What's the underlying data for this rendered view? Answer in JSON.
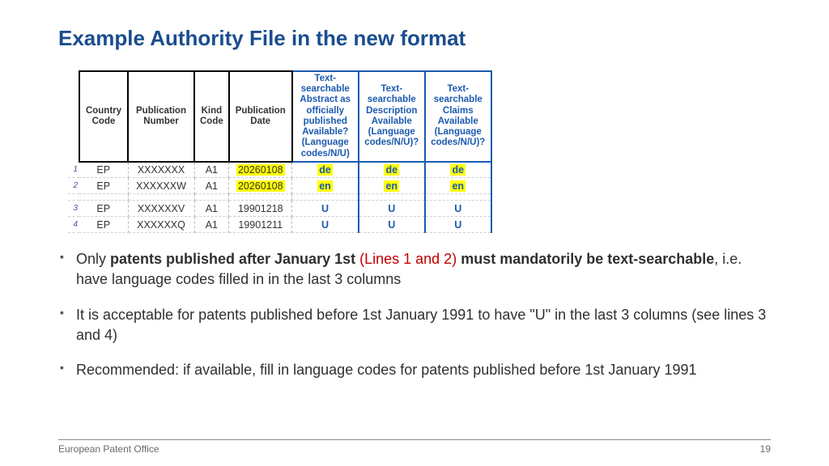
{
  "title": "Example Authority File in the new format",
  "table": {
    "headers": [
      "Country Code",
      "Publication Number",
      "Kind Code",
      "Publication Date",
      "Text-searchable Abstract as officially published Available? (Language codes/N/U)",
      "Text-searchable Description Available (Language codes/N/U)?",
      "Text-searchable Claims Available (Language codes/N/U)?"
    ],
    "rows": [
      {
        "n": "1",
        "cc": "EP",
        "pub": "XXXXXXX",
        "kind": "A1",
        "date": "20260108",
        "a": "de",
        "b": "de",
        "c": "de",
        "hl": true
      },
      {
        "n": "2",
        "cc": "EP",
        "pub": "XXXXXXW",
        "kind": "A1",
        "date": "20260108",
        "a": "en",
        "b": "en",
        "c": "en",
        "hl": true
      },
      {
        "n": "3",
        "cc": "EP",
        "pub": "XXXXXXV",
        "kind": "A1",
        "date": "19901218",
        "a": "U",
        "b": "U",
        "c": "U",
        "hl": false
      },
      {
        "n": "4",
        "cc": "EP",
        "pub": "XXXXXXQ",
        "kind": "A1",
        "date": "19901211",
        "a": "U",
        "b": "U",
        "c": "U",
        "hl": false
      }
    ]
  },
  "bullets": {
    "b1": {
      "p1": "Only ",
      "bold1": "patents published after January 1st ",
      "red": "(Lines 1 and 2) ",
      "bold2": "must mandatorily be text-searchable",
      "tail": ", i.e. have language codes filled in in the last 3 columns"
    },
    "b2": "It is acceptable for patents published before 1st January 1991 to have \"U\" in the last 3 columns (see lines 3 and 4)",
    "b3": "Recommended: if available, fill in language codes for patents published before 1st January 1991"
  },
  "footer": {
    "org": "European Patent Office",
    "page": "19"
  }
}
